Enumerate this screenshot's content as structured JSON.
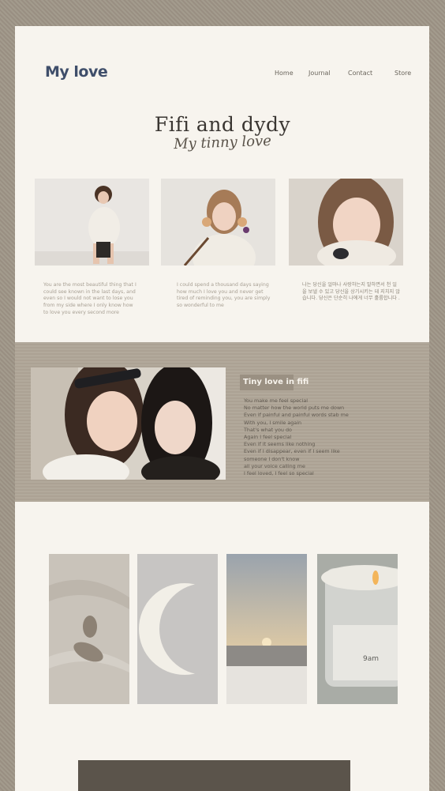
{
  "header": {
    "logo": "My love",
    "nav": [
      "Home",
      "Journal",
      "Contact",
      "Store"
    ]
  },
  "hero": {
    "title": "Fifi and dydy",
    "script": "My tinny love"
  },
  "captions": [
    "You are the most beautiful thing that I could see known in the last days, and even so I would not want to lose you from my side where I only know how to love you every second more",
    "I could spend a thousand days saying how much I love you and never get tired of reminding you, you are simply so wonderful to me",
    "나는 당신을 얼마나 사랑하는지 말하면서 천 일을 보낼 수 있고 당신을 상기시키는 데 지치지 않습니다. 당신은 단순히 나에게 너무 훌륭합니다 ."
  ],
  "feature": {
    "heading": "Tiny love in fifi",
    "lines": [
      "You make me feel special",
      "No matter how the world puts me down",
      "Even if painful and painful words stab me",
      "With you, I smile again",
      "That's what you do",
      "Again I feel special",
      "Even if it seems like nothing",
      "Even if I disappear, even if I seem like",
      "someone I don't know",
      "all your voice calling me",
      "I feel loved, I feel so special"
    ]
  },
  "gallery": {
    "candle_label": "9am"
  },
  "colors": {
    "background": "#9c9486",
    "card": "#f7f4ee",
    "logo": "#3f4e6a",
    "band": "#b0a798",
    "heading_bg": "#9a9082"
  }
}
